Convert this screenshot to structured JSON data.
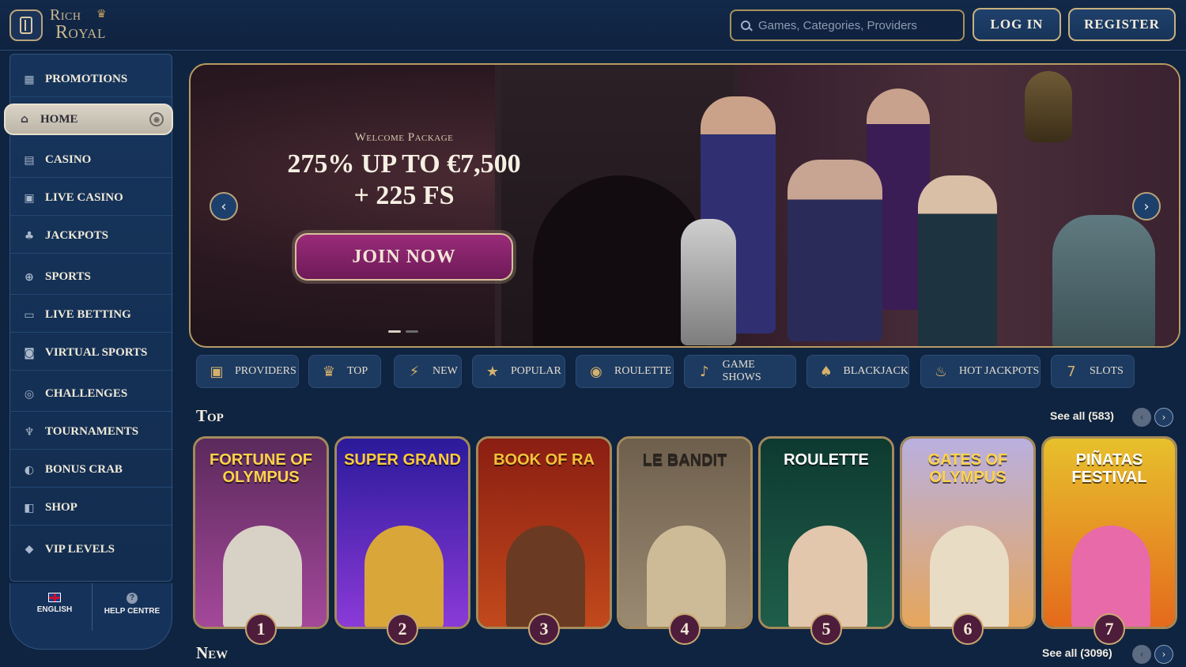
{
  "header": {
    "logo_line1": "Rich",
    "logo_line2": "Royal",
    "search_placeholder": "Games, Categories, Providers",
    "login_label": "LOG IN",
    "register_label": "REGISTER"
  },
  "sidebar": {
    "items": [
      {
        "label": "PROMOTIONS",
        "icon": "gift-icon"
      },
      {
        "label": "HOME",
        "icon": "bank-icon",
        "active": true
      },
      {
        "label": "CASINO",
        "icon": "slot-machine-icon"
      },
      {
        "label": "LIVE CASINO",
        "icon": "live-dealer-icon"
      },
      {
        "label": "JACKPOTS",
        "icon": "clover-icon"
      },
      {
        "label": "SPORTS",
        "icon": "ball-icon"
      },
      {
        "label": "LIVE BETTING",
        "icon": "live-tv-icon"
      },
      {
        "label": "VIRTUAL SPORTS",
        "icon": "virtual-icon"
      },
      {
        "label": "CHALLENGES",
        "icon": "target-icon"
      },
      {
        "label": "TOURNAMENTS",
        "icon": "trophy-icon"
      },
      {
        "label": "BONUS CRAB",
        "icon": "crab-icon"
      },
      {
        "label": "SHOP",
        "icon": "bag-icon"
      },
      {
        "label": "VIP LEVELS",
        "icon": "diamond-icon"
      }
    ],
    "language_label": "ENGLISH",
    "help_label": "HELP CENTRE"
  },
  "banner": {
    "welcome": "Welcome Package",
    "headline_line1": "275% UP TO €7,500",
    "headline_line2": "+ 225 FS",
    "cta": "JOIN NOW",
    "slide_count": 2,
    "active_slide": 1
  },
  "categories": [
    {
      "label": "PROVIDERS",
      "icon": "providers-icon",
      "glyph": "▣"
    },
    {
      "label": "TOP",
      "icon": "crown-icon",
      "glyph": "♛"
    },
    {
      "label": "NEW",
      "icon": "lightning-icon",
      "glyph": "⚡"
    },
    {
      "label": "POPULAR",
      "icon": "star-icon",
      "glyph": "★"
    },
    {
      "label": "ROULETTE",
      "icon": "roulette-icon",
      "glyph": "◉"
    },
    {
      "label": "GAME SHOWS",
      "icon": "microphone-icon",
      "glyph": "♪"
    },
    {
      "label": "BLACKJACK",
      "icon": "cards-icon",
      "glyph": "♠"
    },
    {
      "label": "HOT JACKPOTS",
      "icon": "flame-icon",
      "glyph": "♨"
    },
    {
      "label": "SLOTS",
      "icon": "sevens-icon",
      "glyph": "7"
    }
  ],
  "sections": {
    "top": {
      "title": "Top",
      "see_all": "See all (583)",
      "games": [
        {
          "title": "FORTUNE OF OLYMPUS",
          "rank": "1",
          "colors": [
            "#5b2a5c",
            "#a4489a"
          ],
          "text_color": "#ffd34a",
          "fig_color": "#d8d2c6"
        },
        {
          "title": "SUPER GRAND",
          "rank": "2",
          "colors": [
            "#2a1a9a",
            "#8b3ad8"
          ],
          "text_color": "#ffcc3a",
          "fig_color": "#d9a63a"
        },
        {
          "title": "BOOK OF RA",
          "rank": "3",
          "colors": [
            "#8a1e12",
            "#c2491c"
          ],
          "text_color": "#f2c23a",
          "fig_color": "#6b3a22"
        },
        {
          "title": "LE BANDIT",
          "rank": "4",
          "colors": [
            "#6e5f4d",
            "#9a8a72"
          ],
          "text_color": "#2a2420",
          "fig_color": "#cdbb98"
        },
        {
          "title": "ROULETTE",
          "rank": "5",
          "colors": [
            "#0e3a30",
            "#1f5e4a"
          ],
          "text_color": "#ffffff",
          "fig_color": "#e2c7ad"
        },
        {
          "title": "GATES OF OLYMPUS",
          "rank": "6",
          "colors": [
            "#b9b0e0",
            "#e6a65c"
          ],
          "text_color": "#ffd34a",
          "fig_color": "#e9dcc4"
        },
        {
          "title": "PIÑATAS FESTIVAL",
          "rank": "7",
          "colors": [
            "#e7c02c",
            "#e46a1c"
          ],
          "text_color": "#ffffff",
          "fig_color": "#e86aa8"
        }
      ]
    },
    "new": {
      "title": "New",
      "see_all": "See all (3096)"
    }
  }
}
